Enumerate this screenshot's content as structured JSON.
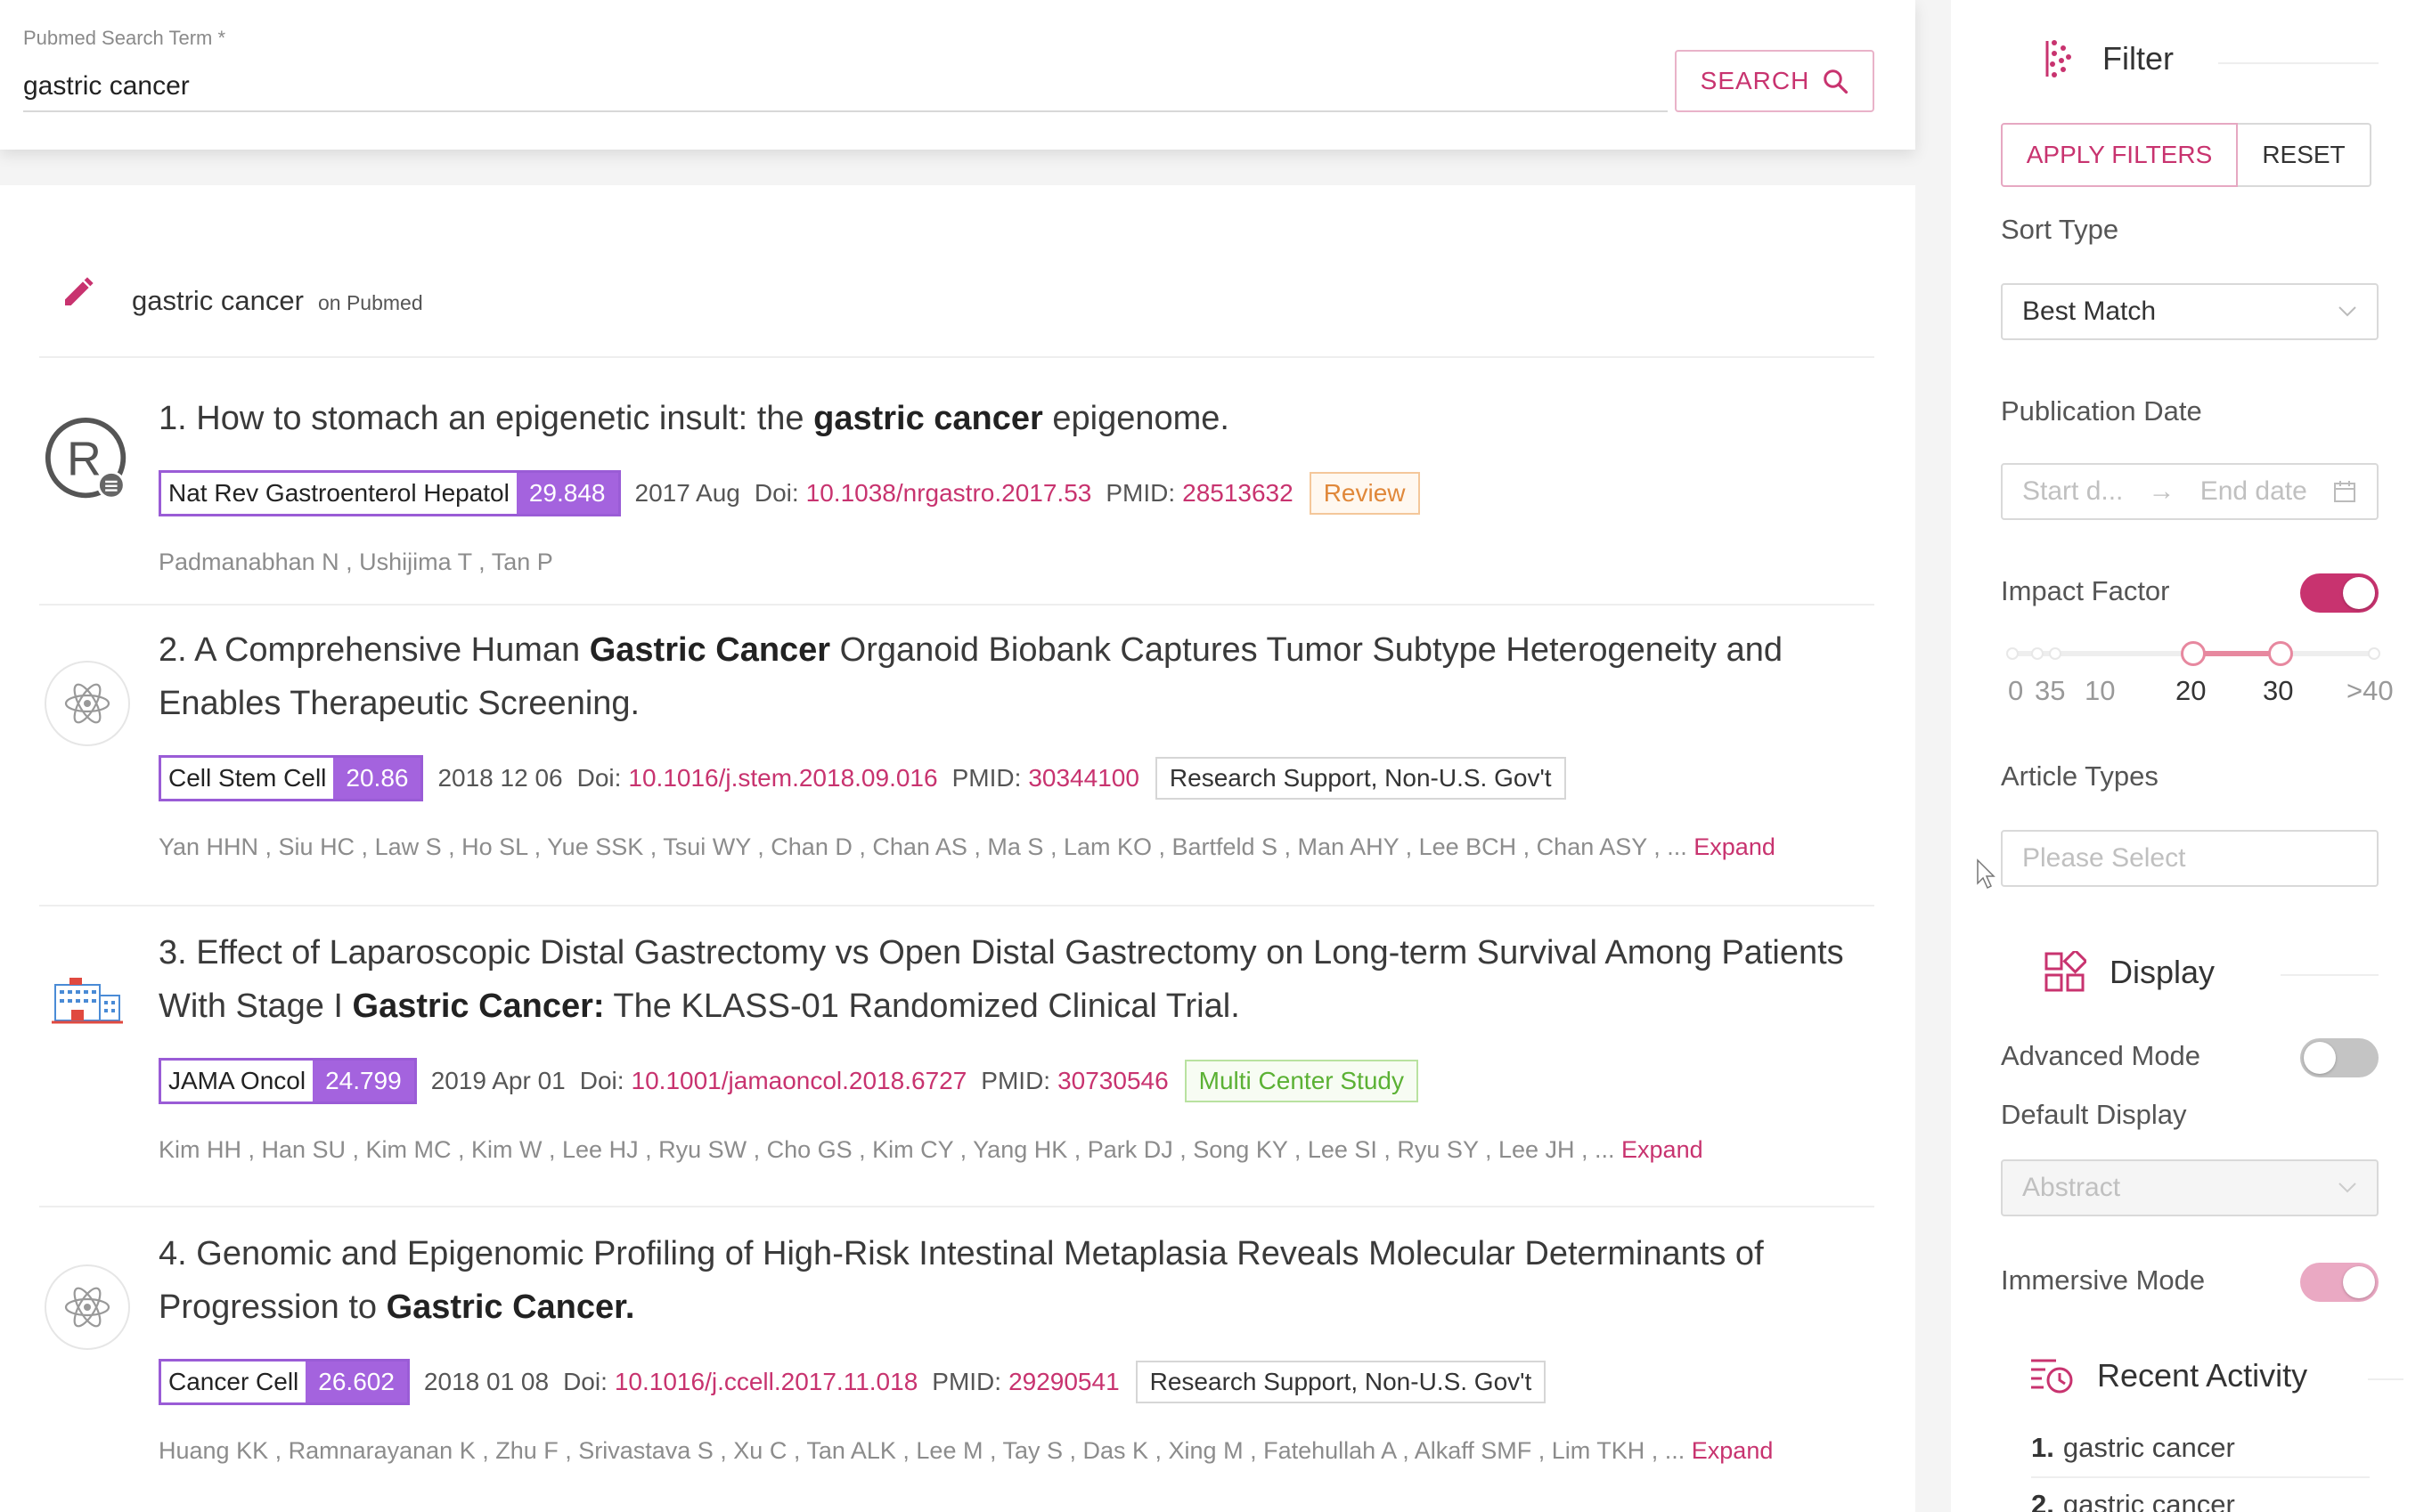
{
  "search": {
    "label": "Pubmed Search Term *",
    "value": "gastric cancer",
    "button": "SEARCH"
  },
  "query": {
    "term": "gastric cancer",
    "source": "on Pubmed"
  },
  "articles": [
    {
      "number": "1.",
      "title_pre": "How to stomach an epigenetic insult: the ",
      "title_bold": "gastric cancer",
      "title_post": " epigenome.",
      "journal": "Nat Rev Gastroenterol Hepatol",
      "impact": "29.848",
      "date": "2017 Aug",
      "doi_label": "Doi:",
      "doi": "10.1038/nrgastro.2017.53",
      "pmid_label": "PMID:",
      "pmid": "28513632",
      "pub_type": "Review",
      "authors": "Padmanabhan N , Ushijima T , Tan P",
      "expand": ""
    },
    {
      "number": "2.",
      "title_pre": "A Comprehensive Human ",
      "title_bold": "Gastric Cancer",
      "title_post": " Organoid Biobank Captures Tumor Subtype Heterogeneity and Enables Therapeutic Screening.",
      "journal": "Cell Stem Cell",
      "impact": "20.86",
      "date": "2018 12 06",
      "doi_label": "Doi:",
      "doi": "10.1016/j.stem.2018.09.016",
      "pmid_label": "PMID:",
      "pmid": "30344100",
      "pub_type": "Research Support, Non-U.S. Gov't",
      "authors": "Yan HHN , Siu HC , Law S , Ho SL , Yue SSK , Tsui WY , Chan D , Chan AS , Ma S , Lam KO , Bartfeld S , Man AHY , Lee BCH , Chan ASY , ... ",
      "expand": "Expand"
    },
    {
      "number": "3.",
      "title_pre": "Effect of Laparoscopic Distal Gastrectomy vs Open Distal Gastrectomy on Long-term Survival Among Patients With Stage I ",
      "title_bold": "Gastric Cancer:",
      "title_post": " The KLASS-01 Randomized Clinical Trial.",
      "journal": "JAMA Oncol",
      "impact": "24.799",
      "date": "2019 Apr 01",
      "doi_label": "Doi:",
      "doi": "10.1001/jamaoncol.2018.6727",
      "pmid_label": "PMID:",
      "pmid": "30730546",
      "pub_type": "Multi Center Study",
      "authors": "Kim HH , Han SU , Kim MC , Kim W , Lee HJ , Ryu SW , Cho GS , Kim CY , Yang HK , Park DJ , Song KY , Lee SI , Ryu SY , Lee JH , ... ",
      "expand": "Expand"
    },
    {
      "number": "4.",
      "title_pre": "Genomic and Epigenomic Profiling of High-Risk Intestinal Metaplasia Reveals Molecular Determinants of Progression to ",
      "title_bold": "Gastric Cancer.",
      "title_post": "",
      "journal": "Cancer Cell",
      "impact": "26.602",
      "date": "2018 01 08",
      "doi_label": "Doi:",
      "doi": "10.1016/j.ccell.2017.11.018",
      "pmid_label": "PMID:",
      "pmid": "29290541",
      "pub_type": "Research Support, Non-U.S. Gov't",
      "authors": "Huang KK , Ramnarayanan K , Zhu F , Srivastava S , Xu C , Tan ALK , Lee M , Tay S , Das K , Xing M , Fatehullah A , Alkaff SMF , Lim TKH , ... ",
      "expand": "Expand"
    }
  ],
  "filter": {
    "title": "Filter",
    "apply": "APPLY FILTERS",
    "reset": "RESET",
    "sort_label": "Sort Type",
    "sort_value": "Best Match",
    "pubdate_label": "Publication Date",
    "start_placeholder": "Start d...",
    "end_placeholder": "End date",
    "impact_label": "Impact Factor",
    "impact_enabled": true,
    "impact_range": [
      20,
      30
    ],
    "impact_marks": [
      "0",
      "35",
      "10",
      "20",
      "30",
      ">40"
    ],
    "article_types_label": "Article Types",
    "article_types_placeholder": "Please Select"
  },
  "display": {
    "title": "Display",
    "advanced_label": "Advanced Mode",
    "advanced_enabled": false,
    "default_label": "Default Display",
    "default_value": "Abstract",
    "immersive_label": "Immersive Mode",
    "immersive_enabled": true
  },
  "recent": {
    "title": "Recent Activity",
    "items": [
      {
        "num": "1.",
        "text": "gastric cancer"
      },
      {
        "num": "2.",
        "text": "gastric cancer"
      }
    ]
  },
  "colors": {
    "accent": "#c8336f",
    "impact_tag": "#a463de",
    "review": "#e0883a",
    "multicenter": "#5bb134"
  }
}
